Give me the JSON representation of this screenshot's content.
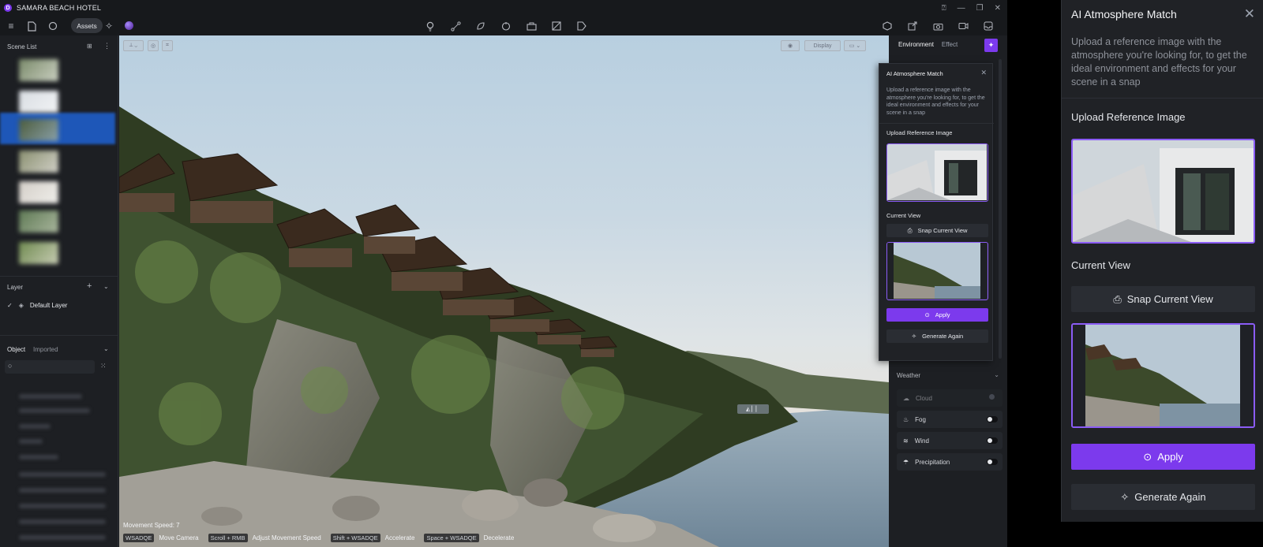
{
  "app": {
    "title": "SAMARA BEACH HOTEL",
    "logo_icon": "app-logo-icon"
  },
  "toolbar": {
    "assets_label": "Assets"
  },
  "left_panel": {
    "scene_list_title": "Scene List",
    "layer_title": "Layer",
    "default_layer": "Default Layer",
    "tabs": [
      "Object",
      "Imported"
    ]
  },
  "viewport": {
    "movement_speed": "Movement Speed: 7",
    "display_label": "Display",
    "shortcuts": [
      {
        "keys": "WSADQE",
        "action": "Move Camera"
      },
      {
        "keys": "Scroll + RMB",
        "action": "Adjust Movement Speed"
      },
      {
        "keys": "Shift + WSADQE",
        "action": "Accelerate"
      },
      {
        "keys": "Space + WSADQE",
        "action": "Decelerate"
      }
    ]
  },
  "env_panel": {
    "tabs": [
      "Environment",
      "Effect"
    ],
    "weather_title": "Weather",
    "weather_items": [
      "Cloud",
      "Fog",
      "Wind",
      "Precipitation"
    ]
  },
  "popup": {
    "title": "AI Atmosphere Match",
    "description": "Upload a reference image with the atmosphere you're looking for, to get the ideal environment and effects for your scene in a snap",
    "upload_heading": "Upload Reference Image",
    "current_view_heading": "Current View",
    "snap_button": "Snap Current View",
    "apply_button": "Apply",
    "generate_button": "Generate Again"
  },
  "colors": {
    "accent": "#7c3aed",
    "selection": "#1e57b8",
    "panel": "#1d1f23"
  }
}
